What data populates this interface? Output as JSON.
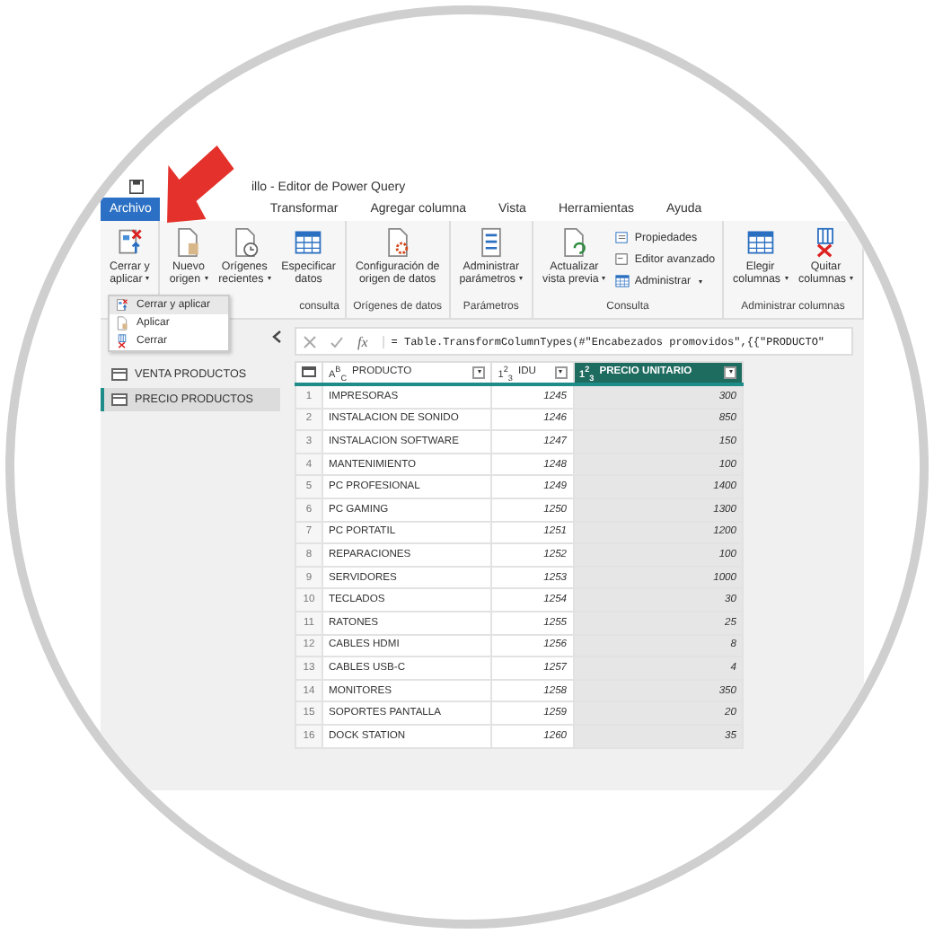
{
  "window": {
    "title": "illo - Editor de Power Query"
  },
  "tabs": [
    {
      "label": "Archivo",
      "selected": true
    },
    {
      "label": "Transformar",
      "selected": false
    },
    {
      "label": "Agregar columna",
      "selected": false
    },
    {
      "label": "Vista",
      "selected": false
    },
    {
      "label": "Herramientas",
      "selected": false
    },
    {
      "label": "Ayuda",
      "selected": false
    }
  ],
  "ribbon": [
    {
      "items": [
        {
          "kind": "large",
          "lines": [
            "Cerrar y",
            "aplicar"
          ],
          "dropdown": true
        }
      ]
    },
    {
      "label": "consulta",
      "items": [
        {
          "kind": "large",
          "lines": [
            "Nuevo",
            "origen"
          ],
          "dropdown": true
        },
        {
          "kind": "large",
          "lines": [
            "Orígenes",
            "recientes"
          ],
          "dropdown": true
        },
        {
          "kind": "large",
          "lines": [
            "Especificar",
            "datos"
          ],
          "dropdown": false
        }
      ]
    },
    {
      "label": "Orígenes de datos",
      "items": [
        {
          "kind": "large",
          "lines": [
            "Configuración de",
            "origen de datos"
          ],
          "dropdown": false
        }
      ]
    },
    {
      "label": "Parámetros",
      "items": [
        {
          "kind": "large",
          "lines": [
            "Administrar",
            "parámetros"
          ],
          "dropdown": true
        }
      ]
    },
    {
      "label": "Consulta",
      "items": [
        {
          "kind": "large",
          "lines": [
            "Actualizar",
            "vista previa"
          ],
          "dropdown": true
        },
        {
          "kind": "small",
          "label": "Propiedades",
          "dropdown": false
        },
        {
          "kind": "small",
          "label": "Editor avanzado",
          "dropdown": false
        },
        {
          "kind": "small",
          "label": "Administrar",
          "dropdown": true
        }
      ]
    },
    {
      "label": "Administrar columnas",
      "items": [
        {
          "kind": "large",
          "lines": [
            "Elegir",
            "columnas"
          ],
          "dropdown": true
        },
        {
          "kind": "large",
          "lines": [
            "Quitar",
            "columnas"
          ],
          "dropdown": true
        }
      ]
    }
  ],
  "menu": [
    {
      "label": "Cerrar y aplicar",
      "selected": true
    },
    {
      "label": "Aplicar",
      "selected": false
    },
    {
      "label": "Cerrar",
      "selected": false
    }
  ],
  "queries": [
    {
      "label": "VENTA PRODUCTOS",
      "selected": false
    },
    {
      "label": "PRECIO PRODUCTOS",
      "selected": true
    }
  ],
  "formula": {
    "fx": "fx",
    "text": "= Table.TransformColumnTypes(#\"Encabezados promovidos\",{{\"PRODUCTO\""
  },
  "table": {
    "columns": [
      {
        "type": "A$^{B}$$_{C}$",
        "name": "PRODUCTO",
        "selected": false
      },
      {
        "type": "1$^{2}$$_{3}$",
        "name": "IDU",
        "selected": false
      },
      {
        "type": "1$^{2}$$_{3}$",
        "name": "PRECIO UNITARIO",
        "selected": true
      }
    ],
    "rows": [
      {
        "number": "1",
        "cells": [
          "IMPRESORAS",
          "1245",
          "300"
        ]
      },
      {
        "number": "2",
        "cells": [
          "INSTALACION DE SONIDO",
          "1246",
          "850"
        ]
      },
      {
        "number": "3",
        "cells": [
          "INSTALACION SOFTWARE",
          "1247",
          "150"
        ]
      },
      {
        "number": "4",
        "cells": [
          "MANTENIMIENTO",
          "1248",
          "100"
        ]
      },
      {
        "number": "5",
        "cells": [
          "PC PROFESIONAL",
          "1249",
          "1400"
        ]
      },
      {
        "number": "6",
        "cells": [
          "PC GAMING",
          "1250",
          "1300"
        ]
      },
      {
        "number": "7",
        "cells": [
          "PC PORTATIL",
          "1251",
          "1200"
        ]
      },
      {
        "number": "8",
        "cells": [
          "REPARACIONES",
          "1252",
          "100"
        ]
      },
      {
        "number": "9",
        "cells": [
          "SERVIDORES",
          "1253",
          "1000"
        ]
      },
      {
        "number": "10",
        "cells": [
          "TECLADOS",
          "1254",
          "30"
        ]
      },
      {
        "number": "11",
        "cells": [
          "RATONES",
          "1255",
          "25"
        ]
      },
      {
        "number": "12",
        "cells": [
          "CABLES HDMI",
          "1256",
          "8"
        ]
      },
      {
        "number": "13",
        "cells": [
          "CABLES USB-C",
          "1257",
          "4"
        ]
      },
      {
        "number": "14",
        "cells": [
          "MONITORES",
          "1258",
          "350"
        ]
      },
      {
        "number": "15",
        "cells": [
          "SOPORTES PANTALLA",
          "1259",
          "20"
        ]
      },
      {
        "number": "16",
        "cells": [
          "DOCK STATION",
          "1260",
          "35"
        ]
      }
    ]
  }
}
